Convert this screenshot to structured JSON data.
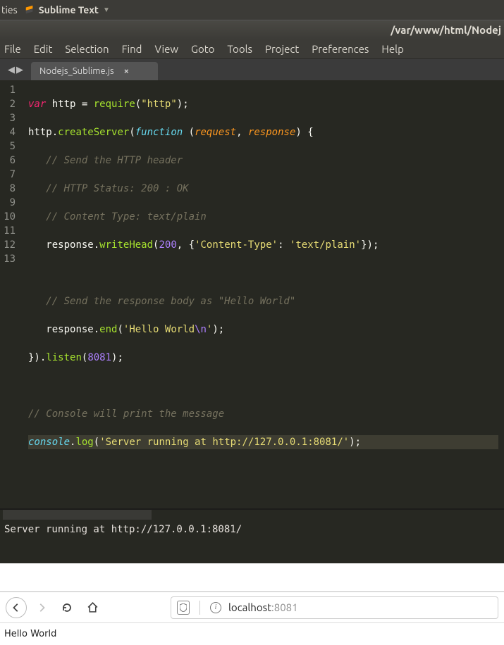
{
  "topbar": {
    "left_fragment": "ties",
    "app": "Sublime Text"
  },
  "window_title": "/var/www/html/Nodej",
  "menu": [
    "File",
    "Edit",
    "Selection",
    "Find",
    "View",
    "Goto",
    "Tools",
    "Project",
    "Preferences",
    "Help"
  ],
  "tab": {
    "name": "Nodejs_Sublime.js"
  },
  "gutter_lines": [
    "1",
    "2",
    "3",
    "4",
    "5",
    "6",
    "7",
    "8",
    "9",
    "10",
    "11",
    "12",
    "13"
  ],
  "code": {
    "l1": {
      "kw": "var",
      "id": "http",
      "eq": " = ",
      "fn": "require",
      "open": "(",
      "str": "\"http\"",
      "close": ");"
    },
    "l2": {
      "obj": "http",
      "dot": ".",
      "m": "createServer",
      "open": "(",
      "fnkw": "function",
      "sp": " ",
      "po": "(",
      "p1": "request",
      "c": ", ",
      "p2": "response",
      "pc": ")",
      "brace": " {"
    },
    "l3": "   // Send the HTTP header",
    "l4": "   // HTTP Status: 200 : OK",
    "l5": "   // Content Type: text/plain",
    "l6": {
      "ind": "   ",
      "obj": "response",
      "dot": ".",
      "m": "writeHead",
      "open": "(",
      "num": "200",
      "c": ", {",
      "k": "'Content-Type'",
      "col": ": ",
      "v": "'text/plain'",
      "close": "});"
    },
    "l7": "",
    "l8": "   // Send the response body as \"Hello World\"",
    "l9": {
      "ind": "   ",
      "obj": "response",
      "dot": ".",
      "m": "end",
      "open": "(",
      "s1": "'Hello World",
      "esc": "\\n",
      "s2": "'",
      "close": ");"
    },
    "l10": {
      "close": "}).",
      "m": "listen",
      "open": "(",
      "num": "8081",
      "end": ");"
    },
    "l11": "",
    "l12": "// Console will print the message",
    "l13": {
      "obj": "console",
      "dot": ".",
      "m": "log",
      "open": "(",
      "str": "'Server running at http://127.0.0.1:8081/'",
      "close": ");"
    }
  },
  "console_output": "Server running at http://127.0.0.1:8081/",
  "browser": {
    "host": "localhost",
    "port": ":8081",
    "body": "Hello World"
  }
}
